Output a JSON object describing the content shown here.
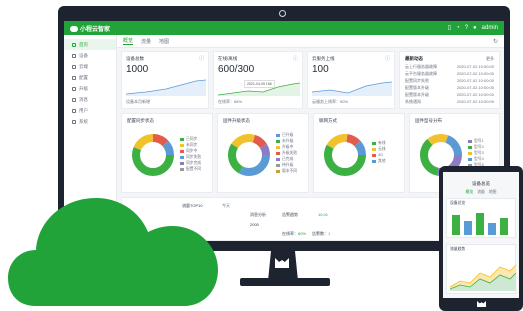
{
  "app": {
    "brand": "小程云智家",
    "user": "admin",
    "colors": {
      "brand_green": "#21a33a",
      "frame": "#1d2430",
      "chart_green": "#3cb043",
      "chart_blue": "#5b9bd5",
      "chart_yellow": "#f2c12e",
      "chart_red": "#e45b4b",
      "chart_purple": "#8e7cc3"
    }
  },
  "sidebar": {
    "items": [
      {
        "label": "首页",
        "icon": "home-icon"
      },
      {
        "label": "设备",
        "icon": "device-icon"
      },
      {
        "label": "云端",
        "icon": "cloud-icon"
      },
      {
        "label": "配置",
        "icon": "settings-icon"
      },
      {
        "label": "升级",
        "icon": "upgrade-icon"
      },
      {
        "label": "消息",
        "icon": "message-icon"
      },
      {
        "label": "用户",
        "icon": "user-icon"
      },
      {
        "label": "系统",
        "icon": "system-icon"
      }
    ]
  },
  "tabs": [
    {
      "label": "概览"
    },
    {
      "label": "流量"
    },
    {
      "label": "地图"
    }
  ],
  "stats": [
    {
      "title": "设备总数",
      "value": "1000",
      "foot": "设备本月新增"
    },
    {
      "title": "在线/离线",
      "value": "600/300",
      "foot": "在线率：68%",
      "tooltip": "2021-04-05  166"
    },
    {
      "title": "云服务上线",
      "value": "100",
      "foot": "云服务上线率：90%"
    }
  ],
  "news": {
    "title": "最新动态",
    "more": "更多",
    "rows": [
      {
        "text": "云上行服务器故障",
        "time": "2020-07-02 10:00:00"
      },
      {
        "text": "云平台服务器故障",
        "time": "2020-07-02 10:00:00"
      },
      {
        "text": "配置同步失败",
        "time": "2020-07-02 10:00:00"
      },
      {
        "text": "配置版本升级",
        "time": "2020-07-02 10:00:00"
      },
      {
        "text": "配置版本升级",
        "time": "2020-07-02 10:00:00"
      },
      {
        "text": "系统通知",
        "time": "2020-07-02 10:00:00"
      }
    ]
  },
  "donut_cards": [
    {
      "title": "配置同步状态",
      "legend": [
        "已同步",
        "未同步",
        "同步中",
        "同步失败",
        "同步完成",
        "配置不同"
      ]
    },
    {
      "title": "固件升级状态",
      "legend": [
        "已升级",
        "未升级",
        "升级中",
        "升级失败",
        "已完成",
        "待升级",
        "版本不同"
      ]
    },
    {
      "title": "联网方式",
      "legend": [
        "有线",
        "无线",
        "4G",
        "其他"
      ]
    },
    {
      "title": "固件型号分布",
      "legend": [
        "型号1",
        "型号2",
        "型号3",
        "型号4",
        "型号5"
      ]
    }
  ],
  "bottom": {
    "top10_title": "流量TOP10",
    "top10_select": "今天",
    "count_label": "消息分析",
    "count_value": "2000",
    "rate_label": "告警趋势",
    "rate_value": "10.01",
    "online_label": "在线率：",
    "online_value": "60%",
    "alarm_label": "告警数：",
    "alarm_value": "1"
  },
  "phone": {
    "title": "设备总览",
    "tabs": [
      "概览",
      "流量",
      "地图"
    ],
    "section1": "设备总览",
    "section2": "流量趋势"
  }
}
